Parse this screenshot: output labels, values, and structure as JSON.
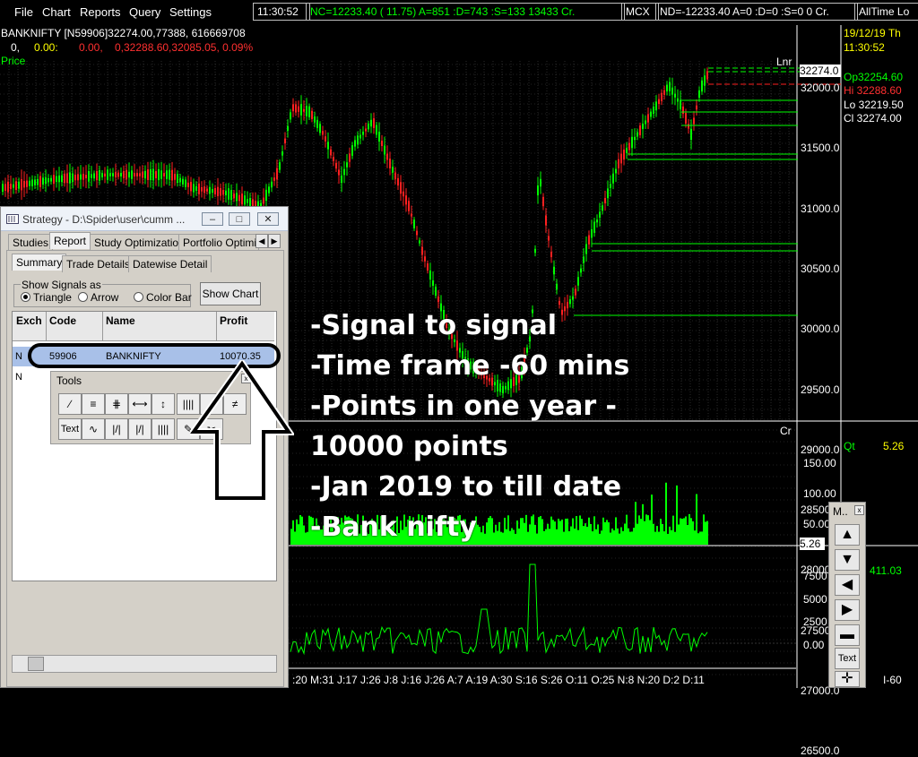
{
  "menu": {
    "items": [
      "File",
      "Chart",
      "Reports",
      "Query",
      "Settings"
    ],
    "time": "11:30:52",
    "nifty_status": "NC=12233.40 (  11.75) A=851 :D=743 :S=133  13433 Cr.",
    "mcx": "MCX",
    "nd_status": "ND=-12233.40 A=0 :D=0 :S=0  0 Cr.",
    "alltime": "AllTime Lo"
  },
  "header": {
    "symbol_line": "BANKNIFTY [N59906]32274.00,77388,  616669708",
    "change_line": [
      "0,",
      "0.00:",
      "0.00,",
      "0,32288.60,32085.05, 0.09%"
    ],
    "price_label": "Price",
    "date": "19/12/19 Th",
    "clock": "11:30:52",
    "lnr": "Lnr",
    "cr": "Cr"
  },
  "ohlc": {
    "open": "Op32254.60",
    "high": "Hi  32288.60",
    "low": "Lo  32219.50",
    "close": "Cl  32274.00",
    "current": "32274.0"
  },
  "price_axis": [
    "32000.0",
    "31500.0",
    "31000.0",
    "30500.0",
    "30000.0",
    "29500.0",
    "29000.0",
    "28500.0",
    "28000.0",
    "27500.0",
    "27000.0",
    "26500.0"
  ],
  "volume_axis": [
    "150.00",
    "100.00",
    "50.00"
  ],
  "volume": {
    "qt_label": "Qt",
    "qt_value": "5.26",
    "current": "5.26"
  },
  "osc_axis": [
    "7500",
    "5000",
    "2500",
    "0.00"
  ],
  "osc": {
    "value": "411.03",
    "period": "I-60"
  },
  "x_axis": ":20 M:31 J:17 J:26 J:8 J:16 J:26 A:7 A:19 A:30 S:16 S:26 O:11 O:25 N:8 N:20 D:2 D:11",
  "strategy": {
    "title": "Strategy - D:\\Spider\\user\\cumm ...",
    "tabs": [
      "Studies",
      "Report",
      "Study Optimization",
      "Portfolio Optimize"
    ],
    "subtabs": [
      "Summary",
      "Trade Details",
      "Datewise Detail"
    ],
    "signals_group": "Show Signals as",
    "signal_options": [
      "Triangle",
      "Arrow",
      "Color Bar"
    ],
    "show_chart": "Show Chart",
    "columns": [
      "Exch",
      "Code",
      "Name",
      "Profit"
    ],
    "rows": [
      {
        "exch": "N",
        "code": "59906",
        "name": "BANKNIFTY",
        "profit": "10070.35"
      },
      {
        "exch": "N",
        "code": "",
        "name": "",
        "profit": ""
      }
    ]
  },
  "tools": {
    "title": "Tools",
    "text_btn": "Text"
  },
  "notes": [
    "-Signal to signal",
    "-Time frame -60 mins",
    "-Points in one year -",
    "10000 points",
    "-Jan 2019 to till date",
    "-Bank nifty"
  ],
  "nav": {
    "title": "M..",
    "text_btn": "Text"
  },
  "colors": {
    "up": "#00ff00",
    "down": "#ff2020",
    "accent": "#ffff00"
  }
}
